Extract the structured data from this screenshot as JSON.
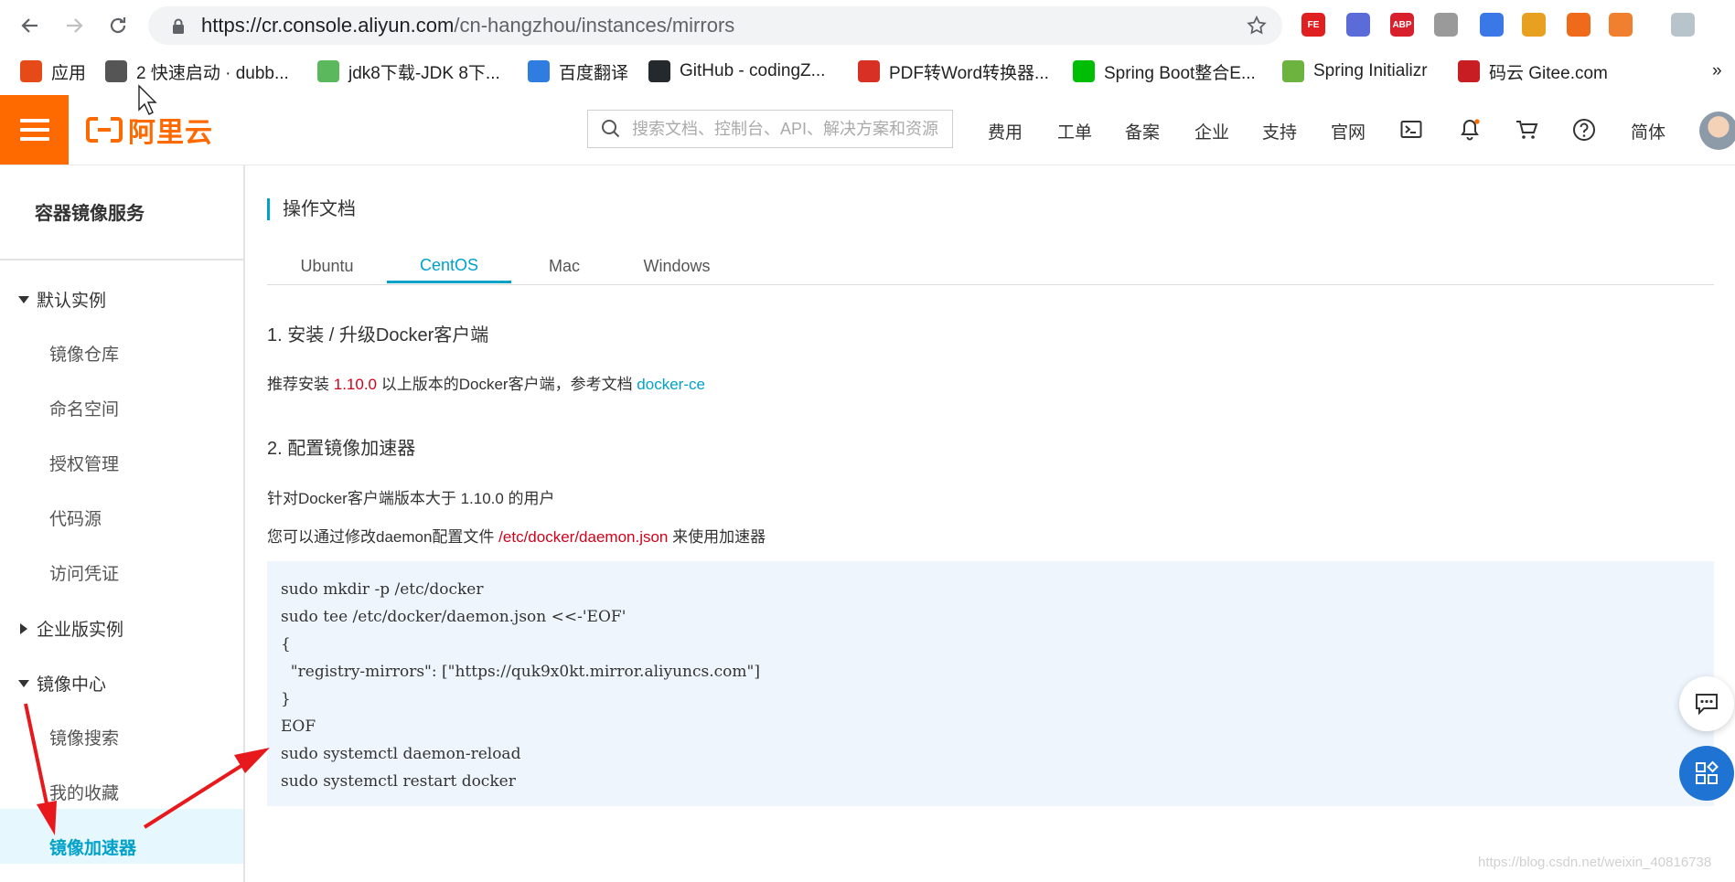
{
  "browser": {
    "url_host": "https://cr.console.aliyun.com",
    "url_path": "/cn-hangzhou/instances/mirrors",
    "extensions": [
      {
        "name": "fe-icon",
        "text": "FE",
        "color": "#e02020"
      },
      {
        "name": "check-circle-icon",
        "text": "",
        "color": "#5b6bd8"
      },
      {
        "name": "adblock-icon",
        "text": "ABP",
        "color": "#d8202c"
      },
      {
        "name": "puzzle-icon",
        "text": "",
        "color": "#9a9a9a"
      },
      {
        "name": "translate-icon",
        "text": "",
        "color": "#3b78e7"
      },
      {
        "name": "pinwheel-icon",
        "text": "",
        "color": "#e8a020"
      },
      {
        "name": "infinity-icon",
        "text": "",
        "color": "#f06a1c"
      },
      {
        "name": "lifebuoy-icon",
        "text": "",
        "color": "#f08030"
      },
      {
        "name": "weather-icon",
        "text": "",
        "color": "#b8c4cc"
      }
    ],
    "bookmarks": [
      {
        "label": "应用",
        "icon": "apps-grid-icon",
        "color": "#e64a19"
      },
      {
        "label": "2 快速启动 · dubb...",
        "icon": "book-icon",
        "color": "#555555"
      },
      {
        "label": "jdk8下载-JDK 8下...",
        "icon": "leaf-icon",
        "color": "#5cb85c"
      },
      {
        "label": "百度翻译",
        "icon": "baidu-translate-icon",
        "color": "#2f7de1"
      },
      {
        "label": "GitHub - codingZ...",
        "icon": "github-icon",
        "color": "#24292e"
      },
      {
        "label": "PDF转Word转换器...",
        "icon": "pdf-icon",
        "color": "#d93025"
      },
      {
        "label": "Spring Boot整合E...",
        "icon": "iqiyi-icon",
        "color": "#00be06"
      },
      {
        "label": "Spring Initializr",
        "icon": "spring-icon",
        "color": "#6db33f"
      },
      {
        "label": "码云 Gitee.com",
        "icon": "gitee-icon",
        "color": "#c71d23"
      }
    ],
    "more_bookmarks": "»"
  },
  "topbar": {
    "logo_text": "阿里云",
    "search_placeholder": "搜索文档、控制台、API、解决方案和资源",
    "links": [
      "费用",
      "工单",
      "备案",
      "企业",
      "支持",
      "官网"
    ],
    "language": "简体",
    "brand_color": "#ff6a00"
  },
  "sidebar": {
    "title": "容器镜像服务",
    "groups": [
      {
        "label": "默认实例",
        "expanded": true,
        "items": [
          "镜像仓库",
          "命名空间",
          "授权管理",
          "代码源",
          "访问凭证"
        ]
      },
      {
        "label": "企业版实例",
        "expanded": false,
        "items": []
      },
      {
        "label": "镜像中心",
        "expanded": true,
        "items": [
          "镜像搜索",
          "我的收藏",
          "镜像加速器"
        ]
      }
    ],
    "active_item": "镜像加速器",
    "accent": "#00a2ca"
  },
  "main": {
    "title": "操作文档",
    "tabs": [
      "Ubuntu",
      "CentOS",
      "Mac",
      "Windows"
    ],
    "active_tab": "CentOS",
    "step1": {
      "heading": "1. 安装 / 升级Docker客户端",
      "text_before": "推荐安装 ",
      "version": "1.10.0",
      "text_after": " 以上版本的Docker客户端，参考文档 ",
      "link": "docker-ce"
    },
    "step2": {
      "heading": "2. 配置镜像加速器",
      "line1": "针对Docker客户端版本大于 1.10.0 的用户",
      "line2_before": "您可以通过修改daemon配置文件 ",
      "file_path": "/etc/docker/daemon.json",
      "line2_after": " 来使用加速器"
    },
    "code_lines": [
      "sudo mkdir -p /etc/docker",
      "sudo tee /etc/docker/daemon.json <<-'EOF'",
      "{",
      "  \"registry-mirrors\": [\"https://quk9x0kt.mirror.aliyuncs.com\"]",
      "}",
      "EOF",
      "sudo systemctl daemon-reload",
      "sudo systemctl restart docker"
    ]
  },
  "watermark": "https://blog.csdn.net/weixin_40816738"
}
